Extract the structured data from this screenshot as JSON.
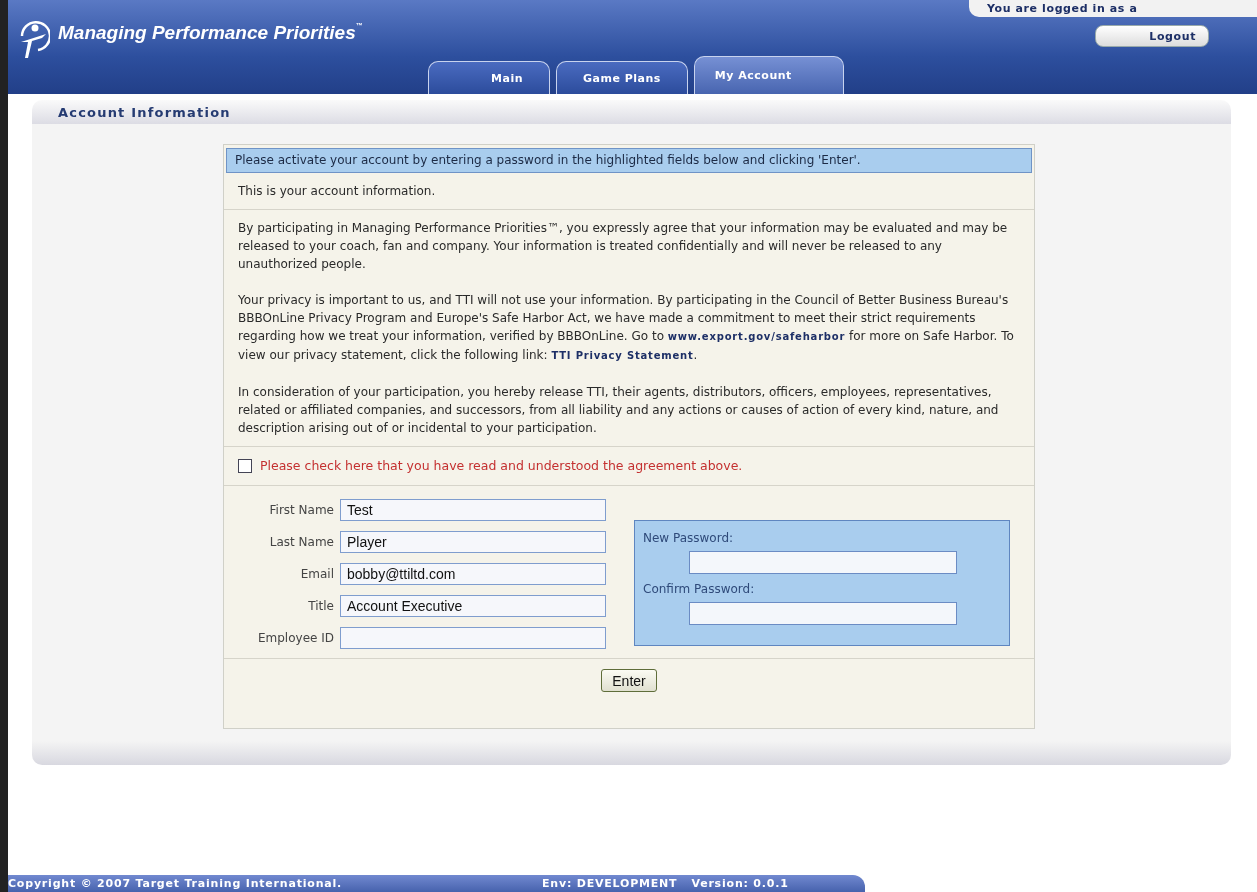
{
  "header": {
    "app_title": "Managing Performance Priorities",
    "tm": "™",
    "login_status": "You are logged in as a",
    "logout": "Logout",
    "tabs": [
      {
        "label": "Main",
        "selected": false
      },
      {
        "label": "Game Plans",
        "selected": false
      },
      {
        "label": "My Account",
        "selected": true
      }
    ]
  },
  "panel": {
    "title": "Account Information"
  },
  "notice": "Please activate your account by entering a password in the highlighted fields below and clicking 'Enter'.",
  "intro": "This is your account information.",
  "agreement_paragraphs": [
    [
      {
        "kind": "text",
        "text": "By participating in Managing Performance Priorities™, you expressly agree that your information may be evaluated and may be released to your coach, fan and company. Your information is treated confidentially and will never be released to any unauthorized people."
      }
    ],
    [
      {
        "kind": "text",
        "text": "Your privacy is important to us, and TTI will not use your information. By participating in the Council of Better Business Bureau's BBBOnLine Privacy Program and Europe's Safe Harbor Act, we have made a commitment to meet their strict requirements regarding how we treat your information, verified by BBBOnLine. Go to "
      },
      {
        "kind": "link",
        "text": "www.export.gov/safeharbor"
      },
      {
        "kind": "text",
        "text": " for more on Safe Harbor. To view our privacy statement, click the following link: "
      },
      {
        "kind": "link",
        "text": "TTI Privacy Statement"
      },
      {
        "kind": "text",
        "text": "."
      }
    ],
    [
      {
        "kind": "text",
        "text": "In consideration of your participation, you hereby release TTI, their agents, distributors, officers, employees, representatives, related or affiliated companies, and successors, from all liability and any actions or causes of action of every kind, nature, and description arising out of or incidental to your participation."
      }
    ]
  ],
  "agree": {
    "label": "Please check here that you have read and understood the agreement above.",
    "checked": false
  },
  "fields": [
    {
      "label": "First Name",
      "value": "Test"
    },
    {
      "label": "Last Name",
      "value": "Player"
    },
    {
      "label": "Email",
      "value": "bobby@ttiltd.com"
    },
    {
      "label": "Title",
      "value": "Account Executive"
    },
    {
      "label": "Employee ID"
    }
  ],
  "password_fields": [
    {
      "label": "New Password:"
    },
    {
      "label": "Confirm Password:"
    }
  ],
  "submit": "Enter",
  "footer": {
    "copyright": "Copyright © 2007 Target Training International.",
    "env": "Env: DEVELOPMENT",
    "version": "Version: 0.0.1"
  }
}
